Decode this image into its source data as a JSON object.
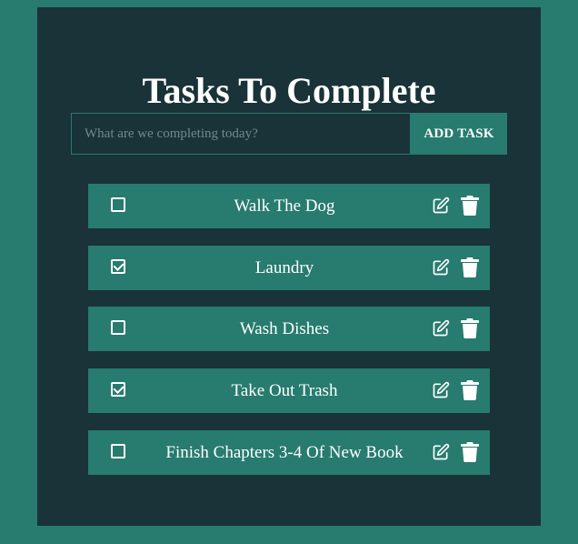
{
  "app": {
    "title": "Tasks To Complete"
  },
  "form": {
    "placeholder": "What are we completing today?",
    "add_label": "ADD TASK"
  },
  "tasks": [
    {
      "label": "Walk The Dog",
      "completed": false
    },
    {
      "label": "Laundry",
      "completed": true
    },
    {
      "label": "Wash Dishes",
      "completed": false
    },
    {
      "label": "Take Out Trash",
      "completed": true
    },
    {
      "label": "Finish Chapters 3-4 Of New Book",
      "completed": false
    }
  ],
  "icons": {
    "edit": "edit-icon",
    "delete": "trash-icon",
    "checkbox": "checkbox"
  },
  "colors": {
    "page_background": "#277b6f",
    "panel_background": "#193338",
    "accent": "#277b6f",
    "text": "#ffffff",
    "placeholder": "#6f8b8c"
  }
}
